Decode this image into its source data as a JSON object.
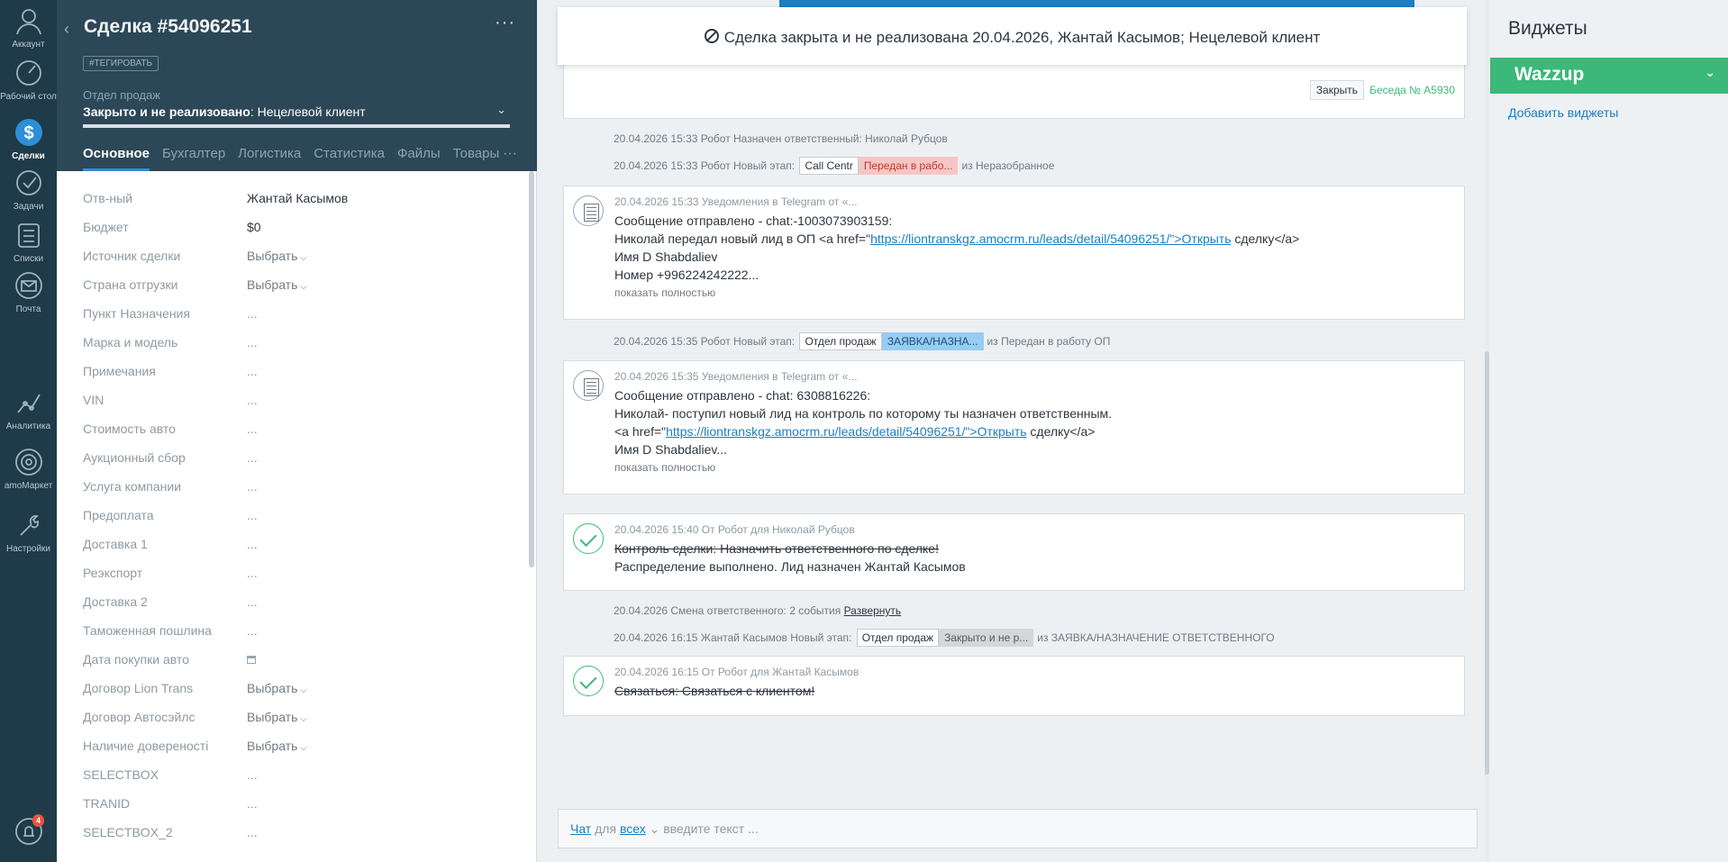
{
  "nav": {
    "items": [
      {
        "label": "Аккаунт",
        "icon": "avatar-icon"
      },
      {
        "label": "Рабочий стол",
        "icon": "dashboard-icon"
      },
      {
        "label": "Сделки",
        "icon": "deals-icon"
      },
      {
        "label": "Задачи",
        "icon": "tasks-icon"
      },
      {
        "label": "Списки",
        "icon": "lists-icon"
      },
      {
        "label": "Почта",
        "icon": "mail-icon"
      },
      {
        "label": "Аналитика",
        "icon": "analytics-icon"
      },
      {
        "label": "amoМаркет",
        "icon": "market-icon"
      },
      {
        "label": "Настройки",
        "icon": "settings-icon"
      }
    ],
    "notifications_count": "4"
  },
  "card": {
    "title": "Сделка #54096251",
    "tag_button": "#ТЕГИРОВАТЬ",
    "pipeline": "Отдел продаж",
    "status_prefix": "Закрыто и не реализовано",
    "status_suffix": ": Нецелевой клиент",
    "tabs": [
      "Основное",
      "Бухгалтер",
      "Логистика",
      "Статистика",
      "Файлы",
      "Товары"
    ],
    "fields": [
      {
        "label": "Отв-ный",
        "value": "Жантай Касымов",
        "kind": "text"
      },
      {
        "label": "Бюджет",
        "value": "$0",
        "kind": "text"
      },
      {
        "label": "Источник сделки",
        "value": "Выбрать",
        "kind": "select"
      },
      {
        "label": "Страна отгрузки",
        "value": "Выбрать",
        "kind": "select"
      },
      {
        "label": "Пункт Назначения",
        "value": "...",
        "kind": "muted"
      },
      {
        "label": "Марка и модель",
        "value": "...",
        "kind": "muted"
      },
      {
        "label": "Примечания",
        "value": "...",
        "kind": "muted"
      },
      {
        "label": "VIN",
        "value": "...",
        "kind": "muted"
      },
      {
        "label": "Стоимость авто",
        "value": "...",
        "kind": "muted"
      },
      {
        "label": "Аукционный сбор",
        "value": "...",
        "kind": "muted"
      },
      {
        "label": "Услуга компании",
        "value": "...",
        "kind": "muted"
      },
      {
        "label": "Предоплата",
        "value": "...",
        "kind": "muted"
      },
      {
        "label": "Доставка 1",
        "value": "...",
        "kind": "muted"
      },
      {
        "label": "Реэкспорт",
        "value": "...",
        "kind": "muted"
      },
      {
        "label": "Доставка 2",
        "value": "...",
        "kind": "muted"
      },
      {
        "label": "Таможенная пошлина",
        "value": "...",
        "kind": "muted"
      },
      {
        "label": "Дата покупки авто",
        "value": "",
        "kind": "date"
      },
      {
        "label": "Договор Lion Trans",
        "value": "Выбрать",
        "kind": "select"
      },
      {
        "label": "Договор Автосэйлс",
        "value": "Выбрать",
        "kind": "select"
      },
      {
        "label": "Наличие довереності",
        "value": "Выбрать",
        "kind": "select"
      },
      {
        "label": "SELECTBOX",
        "value": "...",
        "kind": "muted"
      },
      {
        "label": "TRANID",
        "value": "...",
        "kind": "muted"
      },
      {
        "label": "SELECTBOX_2",
        "value": "...",
        "kind": "muted"
      }
    ]
  },
  "feed": {
    "closed_banner": "Сделка закрыта и не реализована 20.04.2026, Жантай Касымов; Нецелевой клиент",
    "close_button": "Закрыть",
    "chat_link": "Беседа № A5930",
    "sys1": "20.04.2026 15:33 Робот Назначен ответственный: Николай Рубцов",
    "sys2_text": "20.04.2026 15:33 Робот Новый этап:",
    "sys2_pill1": "Call Centr",
    "sys2_pill2": "Передан в рабо...",
    "sys2_from": "из Неразобранное",
    "note1": {
      "meta": "20.04.2026 15:33 Уведомления в Telegram от «...",
      "line1": "Сообщение отправлено - chat:-1003073903159:",
      "line2a": "Николай передал новый лид в ОП <a href=\"",
      "line2link": "https://liontranskgz.amocrm.ru/leads/detail/54096251/\">Открыть",
      "line2b": " сделку</a>",
      "line3": "Имя D Shabdaliev",
      "line4": "Номер +996224242222...",
      "more": "показать полностью"
    },
    "sys3_text": "20.04.2026 15:35 Робот Новый этап:",
    "sys3_pill1": "Отдел продаж",
    "sys3_pill2": "ЗАЯВКА/НАЗНА...",
    "sys3_from": "из Передан в работу ОП",
    "note2": {
      "meta": "20.04.2026 15:35 Уведомления в Telegram от «...",
      "line1": "Сообщение отправлено - chat: 6308816226:",
      "line2": "Николай- поступил новый лид на контроль по которому ты назначен ответственным.",
      "line3a": "<a href=\"",
      "line3link": "https://liontranskgz.amocrm.ru/leads/detail/54096251/\">Открыть",
      "line3b": " сделку</a>",
      "line4": "Имя D Shabdaliev...",
      "more": "показать полностью"
    },
    "task1": {
      "meta": "20.04.2026 15:40  От Робот для Николай Рубцов",
      "line1": "Контроль сделки: Назначить ответственного по сделке!",
      "line2": "Распределение выполнено. Лид назначен Жантай Касымов"
    },
    "sys4_text": "20.04.2026 Смена ответственного: 2 события",
    "sys4_link": "Развернуть",
    "sys5_text": "20.04.2026 16:15 Жантай Касымов Новый этап:",
    "sys5_pill1": "Отдел продаж",
    "sys5_pill2": "Закрыто и не р...",
    "sys5_from": "из ЗАЯВКА/НАЗНАЧЕНИЕ ОТВЕТСТВЕННОГО",
    "task2": {
      "meta": "20.04.2026 16:15  От Робот для Жантай Касымов",
      "line1": "Связаться: Связаться с клиентом!"
    },
    "composer": {
      "chat": "Чат",
      "for": "для",
      "all": "всех",
      "placeholder": "введите текст ..."
    }
  },
  "widgets": {
    "title": "Виджеты",
    "wazzup": "Wazzup",
    "add": "Добавить виджеты"
  },
  "colors": {
    "sidebar": "#1f3a48",
    "card_header": "#2c4757",
    "accent_blue": "#1c7ec4",
    "green": "#3cb878"
  }
}
